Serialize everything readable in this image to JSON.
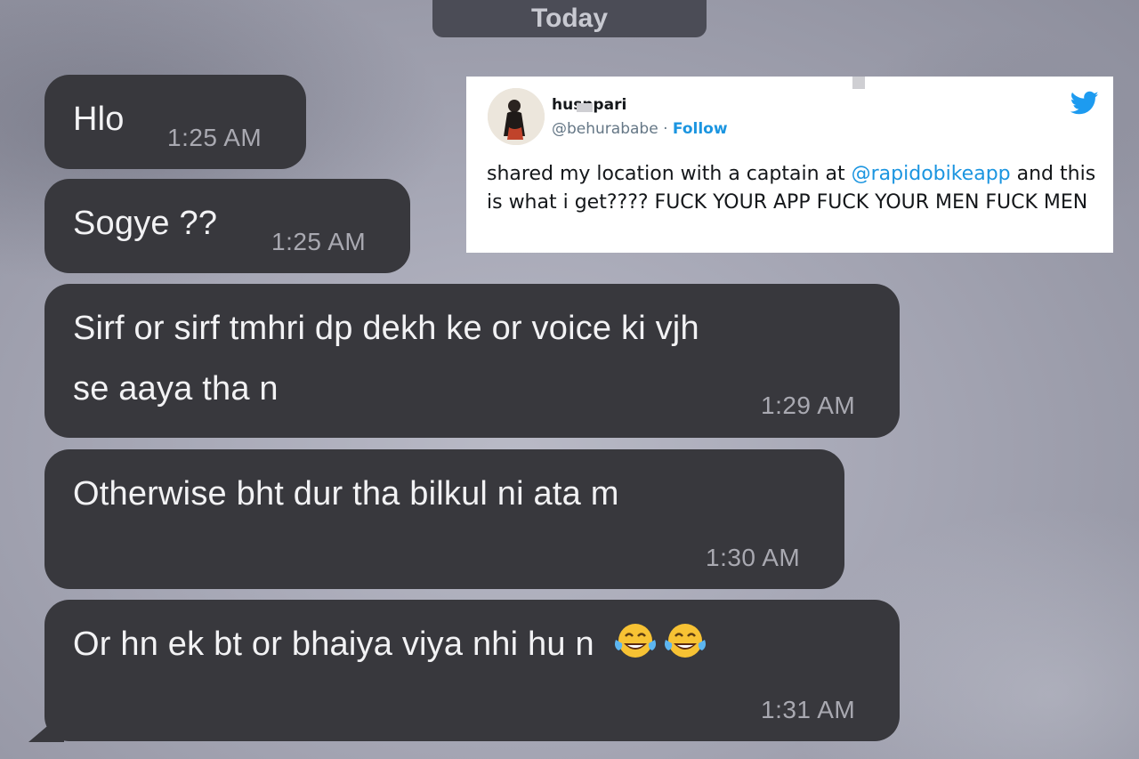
{
  "chat": {
    "date_separator": "Today",
    "messages": [
      {
        "text": "Hlo",
        "time": "1:25 AM"
      },
      {
        "text": "Sogye ??",
        "time": "1:25 AM"
      },
      {
        "text_line1": "Sirf or sirf tmhri dp dekh ke or voice ki vjh",
        "text_line2": "se aaya tha n",
        "time": "1:29 AM"
      },
      {
        "text": "Otherwise bht dur tha bilkul  ni ata m",
        "time": "1:30 AM"
      },
      {
        "text": "Or hn ek bt or bhaiya viya nhi hu n",
        "emoji": "face-with-tears-of-joy x2",
        "time": "1:31 AM"
      }
    ]
  },
  "tweet": {
    "display_name": "husnpari",
    "handle": "@behurababe",
    "separator": " · ",
    "follow_label": "Follow",
    "text_part1": "shared my location with a captain at ",
    "mention": "@rapidobikeapp",
    "text_part2": " and this is what i get???? FUCK YOUR APP FUCK YOUR MEN FUCK MEN",
    "platform_icon": "twitter-bird-icon",
    "accent_color": "#1b95e0"
  },
  "colors": {
    "bubble": "#38383d",
    "bubble_text": "#f2f2f4",
    "timestamp": "#a9a9b1",
    "date_pill": "#4b4c56"
  }
}
